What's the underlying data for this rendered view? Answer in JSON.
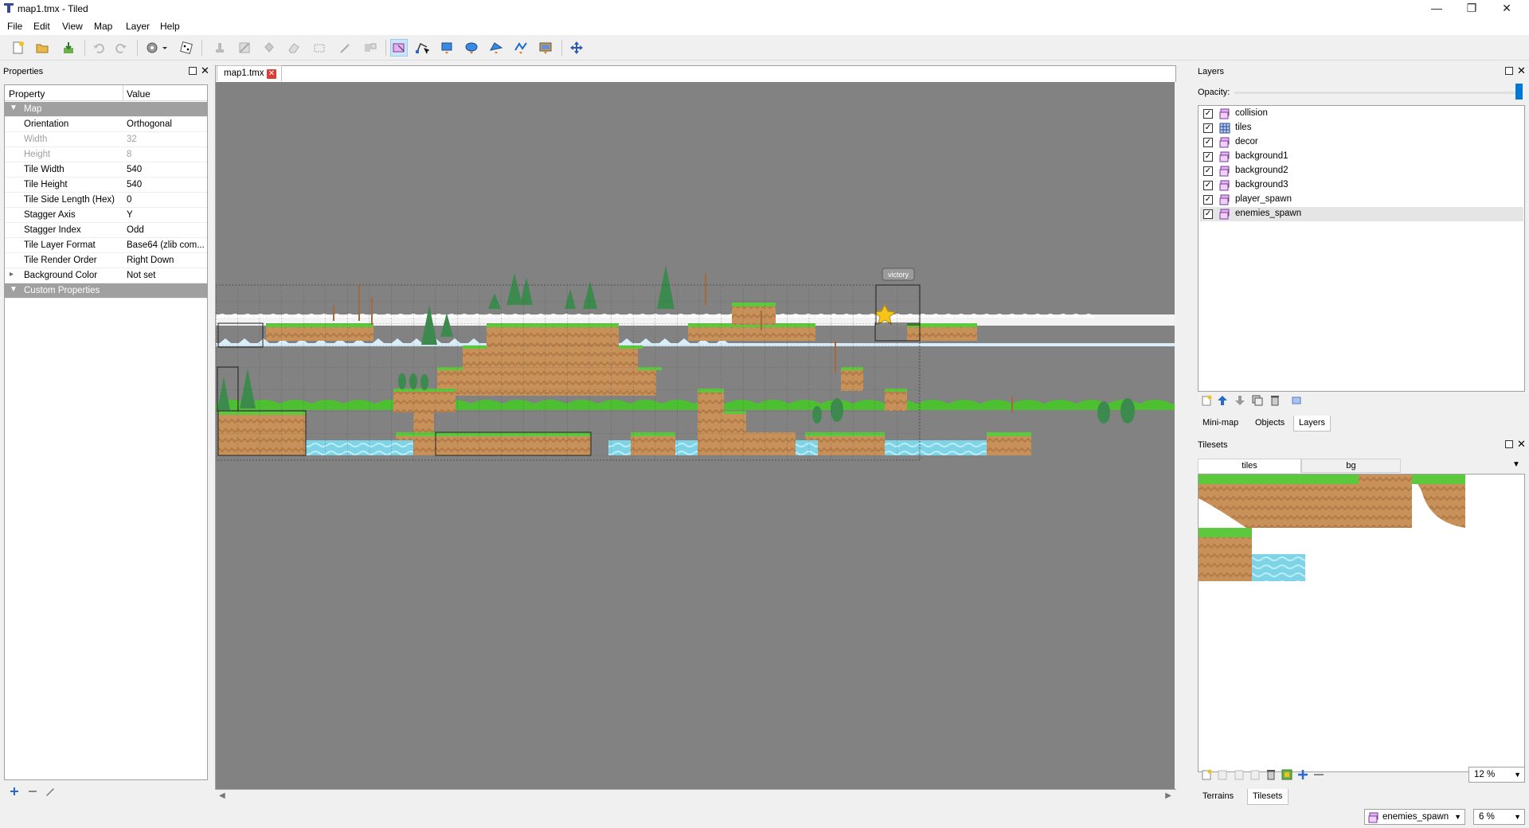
{
  "window": {
    "title": "map1.tmx - Tiled"
  },
  "menu": [
    "File",
    "Edit",
    "View",
    "Map",
    "Layer",
    "Help"
  ],
  "properties_panel": {
    "title": "Properties",
    "header": {
      "property": "Property",
      "value": "Value"
    },
    "group_map": "Map",
    "rows": [
      {
        "key": "Orientation",
        "value": "Orthogonal",
        "disabled": false
      },
      {
        "key": "Width",
        "value": "32",
        "disabled": true
      },
      {
        "key": "Height",
        "value": "8",
        "disabled": true
      },
      {
        "key": "Tile Width",
        "value": "540",
        "disabled": false
      },
      {
        "key": "Tile Height",
        "value": "540",
        "disabled": false
      },
      {
        "key": "Tile Side Length (Hex)",
        "value": "0",
        "disabled": false
      },
      {
        "key": "Stagger Axis",
        "value": "Y",
        "disabled": false
      },
      {
        "key": "Stagger Index",
        "value": "Odd",
        "disabled": false
      },
      {
        "key": "Tile Layer Format",
        "value": "Base64 (zlib com...",
        "disabled": false
      },
      {
        "key": "Tile Render Order",
        "value": "Right Down",
        "disabled": false
      },
      {
        "key": "Background Color",
        "value": "Not set",
        "disabled": false
      }
    ],
    "group_custom": "Custom Properties"
  },
  "editor": {
    "tab_label": "map1.tmx",
    "victory_label": "victory"
  },
  "layers_panel": {
    "title": "Layers",
    "opacity_label": "Opacity:",
    "layers": [
      {
        "name": "collision",
        "type": "object",
        "visible": true,
        "selected": false
      },
      {
        "name": "tiles",
        "type": "tile",
        "visible": true,
        "selected": false
      },
      {
        "name": "decor",
        "type": "object",
        "visible": true,
        "selected": false
      },
      {
        "name": "background1",
        "type": "object",
        "visible": true,
        "selected": false
      },
      {
        "name": "background2",
        "type": "object",
        "visible": true,
        "selected": false
      },
      {
        "name": "background3",
        "type": "object",
        "visible": true,
        "selected": false
      },
      {
        "name": "player_spawn",
        "type": "object",
        "visible": true,
        "selected": false
      },
      {
        "name": "enemies_spawn",
        "type": "object",
        "visible": true,
        "selected": true
      }
    ],
    "bottom_tabs": [
      "Mini-map",
      "Objects",
      "Layers"
    ],
    "active_bottom_tab": "Layers"
  },
  "tilesets_panel": {
    "title": "Tilesets",
    "tabs": [
      "tiles",
      "bg"
    ],
    "active_tab": "tiles",
    "zoom": "12 %",
    "bottom_tabs": [
      "Terrains",
      "Tilesets"
    ],
    "active_bottom_tab": "Tilesets"
  },
  "status": {
    "current_layer": "enemies_spawn",
    "zoom": "6 %"
  },
  "colors": {
    "canvas_bg": "#828282",
    "dirt": "#c8915a",
    "grass": "#5cc83c",
    "water": "#7ed4e6",
    "tree": "#3c8a4e",
    "accent_selection": "#cce4f7"
  }
}
